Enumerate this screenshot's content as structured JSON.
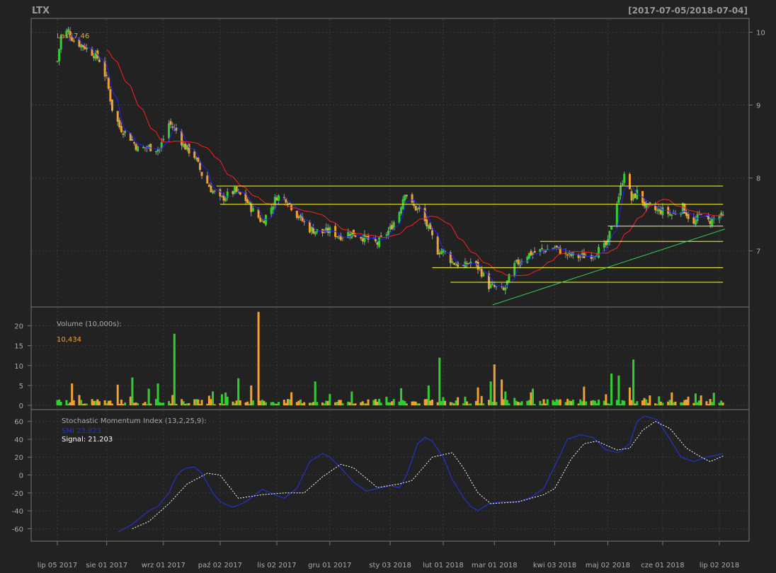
{
  "header": {
    "symbol": "LTX",
    "range": "[2017-07-05/2018-07-04]"
  },
  "colors": {
    "background": "#222222",
    "panel_border": "#777777",
    "grid": "#3a3a3a",
    "axis_text": "#aaaaaa",
    "header_text": "#999999",
    "up_candle": "#33cc33",
    "down_candle": "#f0a030",
    "wick": "#999999",
    "fast_ma": "#2222ff",
    "slow_ma": "#ff2020",
    "support_lines": "#ffff33",
    "trend_line": "#33cc55",
    "smi_line": "#2233cc",
    "signal_line": "#ffffff",
    "last_label": "#f0a030",
    "panel_label": "#aaaaaa"
  },
  "chart_data": [
    {
      "type": "candlestick",
      "panel": "price",
      "last_label": "Last 7.46",
      "ylim": [
        6.25,
        10.15
      ],
      "yticks": [
        7,
        8,
        9,
        10
      ],
      "grid": true,
      "x_labels": [
        "lip 05 2017",
        "sie 01 2017",
        "wrz 01 2017",
        "paź 02 2017",
        "lis 02 2017",
        "gru 01 2017",
        "sty 03 2018",
        "lut 01 2018",
        "mar 01 2018",
        "kwi 03 2018",
        "maj 02 2018",
        "cze 01 2018",
        "lip 02 2018"
      ],
      "x_label_dates": [
        "2017-07-05",
        "2017-08-01",
        "2017-09-01",
        "2017-10-02",
        "2017-11-02",
        "2017-12-01",
        "2018-01-03",
        "2018-02-01",
        "2018-03-01",
        "2018-04-03",
        "2018-05-02",
        "2018-06-01",
        "2018-07-02"
      ],
      "close_anchors": [
        [
          "2017-07-05",
          9.6
        ],
        [
          "2017-07-07",
          9.95
        ],
        [
          "2017-07-11",
          10.02
        ],
        [
          "2017-07-14",
          9.88
        ],
        [
          "2017-07-20",
          9.8
        ],
        [
          "2017-07-25",
          9.7
        ],
        [
          "2017-07-28",
          9.62
        ],
        [
          "2017-08-01",
          9.35
        ],
        [
          "2017-08-04",
          8.95
        ],
        [
          "2017-08-08",
          8.7
        ],
        [
          "2017-08-14",
          8.55
        ],
        [
          "2017-08-18",
          8.4
        ],
        [
          "2017-08-24",
          8.42
        ],
        [
          "2017-08-30",
          8.4
        ],
        [
          "2017-09-04",
          8.75
        ],
        [
          "2017-09-08",
          8.65
        ],
        [
          "2017-09-12",
          8.45
        ],
        [
          "2017-09-18",
          8.3
        ],
        [
          "2017-09-22",
          8.05
        ],
        [
          "2017-09-27",
          7.85
        ],
        [
          "2017-10-02",
          7.7
        ],
        [
          "2017-10-05",
          7.75
        ],
        [
          "2017-10-10",
          7.82
        ],
        [
          "2017-10-16",
          7.7
        ],
        [
          "2017-10-20",
          7.55
        ],
        [
          "2017-10-25",
          7.4
        ],
        [
          "2017-10-30",
          7.6
        ],
        [
          "2017-11-02",
          7.75
        ],
        [
          "2017-11-07",
          7.72
        ],
        [
          "2017-11-13",
          7.5
        ],
        [
          "2017-11-20",
          7.3
        ],
        [
          "2017-11-27",
          7.25
        ],
        [
          "2017-12-01",
          7.28
        ],
        [
          "2017-12-06",
          7.2
        ],
        [
          "2017-12-12",
          7.25
        ],
        [
          "2017-12-18",
          7.2
        ],
        [
          "2017-12-27",
          7.1
        ],
        [
          "2018-01-03",
          7.3
        ],
        [
          "2018-01-08",
          7.55
        ],
        [
          "2018-01-11",
          7.82
        ],
        [
          "2018-01-15",
          7.62
        ],
        [
          "2018-01-19",
          7.55
        ],
        [
          "2018-01-24",
          7.3
        ],
        [
          "2018-01-29",
          7.0
        ],
        [
          "2018-02-01",
          7.0
        ],
        [
          "2018-02-06",
          6.85
        ],
        [
          "2018-02-12",
          6.78
        ],
        [
          "2018-02-16",
          6.85
        ],
        [
          "2018-02-21",
          6.75
        ],
        [
          "2018-02-26",
          6.52
        ],
        [
          "2018-03-01",
          6.5
        ],
        [
          "2018-03-06",
          6.45
        ],
        [
          "2018-03-12",
          6.8
        ],
        [
          "2018-03-19",
          6.95
        ],
        [
          "2018-03-26",
          7.0
        ],
        [
          "2018-04-03",
          7.05
        ],
        [
          "2018-04-09",
          6.95
        ],
        [
          "2018-04-16",
          6.92
        ],
        [
          "2018-04-23",
          6.95
        ],
        [
          "2018-04-30",
          7.05
        ],
        [
          "2018-05-02",
          7.1
        ],
        [
          "2018-05-05",
          7.5
        ],
        [
          "2018-05-09",
          7.85
        ],
        [
          "2018-05-11",
          8.1
        ],
        [
          "2018-05-15",
          7.7
        ],
        [
          "2018-05-18",
          7.8
        ],
        [
          "2018-05-23",
          7.6
        ],
        [
          "2018-05-29",
          7.55
        ],
        [
          "2018-06-01",
          7.55
        ],
        [
          "2018-06-06",
          7.5
        ],
        [
          "2018-06-12",
          7.6
        ],
        [
          "2018-06-18",
          7.35
        ],
        [
          "2018-06-22",
          7.55
        ],
        [
          "2018-06-26",
          7.4
        ],
        [
          "2018-07-02",
          7.48
        ],
        [
          "2018-07-04",
          7.46
        ]
      ],
      "overlays": {
        "fast_ma_period": 5,
        "slow_ma_period": 20,
        "horizontal_lines": [
          {
            "y": 7.89,
            "from": "2017-09-30",
            "to": "2018-07-04"
          },
          {
            "y": 7.64,
            "from": "2017-10-02",
            "to": "2018-07-04"
          },
          {
            "y": 7.34,
            "from": "2018-05-02",
            "to": "2018-07-04"
          },
          {
            "y": 7.13,
            "from": "2018-03-26",
            "to": "2018-07-04"
          },
          {
            "y": 6.77,
            "from": "2018-01-26",
            "to": "2018-07-04"
          },
          {
            "y": 6.57,
            "from": "2018-02-05",
            "to": "2018-07-04"
          }
        ],
        "trend_line": {
          "from": [
            "2018-02-28",
            6.26
          ],
          "to": [
            "2018-07-05",
            7.3
          ]
        }
      }
    },
    {
      "type": "bar",
      "panel": "volume",
      "title": "Volume (10,000s):",
      "last_value": "10,434",
      "ylim": [
        0,
        24
      ],
      "yticks": [
        0,
        5,
        10,
        15,
        20
      ],
      "grid": true,
      "peaks": [
        [
          "2017-07-13",
          5.5
        ],
        [
          "2017-08-07",
          5.2
        ],
        [
          "2017-08-15",
          7.0
        ],
        [
          "2017-08-24",
          4.2
        ],
        [
          "2017-08-29",
          5.5
        ],
        [
          "2017-09-07",
          18.0
        ],
        [
          "2017-09-09",
          5.6
        ],
        [
          "2017-09-28",
          3.5
        ],
        [
          "2017-10-12",
          6.8
        ],
        [
          "2017-10-19",
          5.0
        ],
        [
          "2017-10-23",
          23.5
        ],
        [
          "2017-11-23",
          6.0
        ],
        [
          "2017-12-13",
          3.5
        ],
        [
          "2018-01-09",
          4.3
        ],
        [
          "2018-01-24",
          5.0
        ],
        [
          "2018-01-30",
          12.0
        ],
        [
          "2018-01-27",
          6.0
        ],
        [
          "2018-02-20",
          4.5
        ],
        [
          "2018-02-27",
          6.0
        ],
        [
          "2018-03-01",
          10.3
        ],
        [
          "2018-03-05",
          6.5
        ],
        [
          "2018-03-22",
          4.2
        ],
        [
          "2018-04-19",
          4.7
        ],
        [
          "2018-05-04",
          8.0
        ],
        [
          "2018-05-06",
          10.8
        ],
        [
          "2018-05-08",
          7.5
        ],
        [
          "2018-05-14",
          4.5
        ],
        [
          "2018-05-16",
          11.5
        ],
        [
          "2018-05-25",
          2.5
        ],
        [
          "2018-06-22",
          2.5
        ],
        [
          "2018-07-01",
          10.0
        ]
      ]
    },
    {
      "type": "line",
      "panel": "oscillator",
      "title": "Stochastic Momentum Index (13,2,25,9):",
      "series": [
        {
          "name": "SMI",
          "last_value": "23.823"
        },
        {
          "name": "Signal",
          "last_value": "21.203"
        }
      ],
      "ylim": [
        -70,
        70
      ],
      "yticks": [
        -60,
        -40,
        -20,
        0,
        20,
        40,
        60
      ],
      "grid": true,
      "smi_anchors": [
        [
          "2017-08-07",
          -64
        ],
        [
          "2017-08-15",
          -55
        ],
        [
          "2017-08-24",
          -40
        ],
        [
          "2017-08-29",
          -35
        ],
        [
          "2017-09-04",
          -20
        ],
        [
          "2017-09-09",
          3
        ],
        [
          "2017-09-14",
          8
        ],
        [
          "2017-09-18",
          9
        ],
        [
          "2017-09-22",
          2
        ],
        [
          "2017-09-28",
          -20
        ],
        [
          "2017-10-02",
          -30
        ],
        [
          "2017-10-09",
          -36
        ],
        [
          "2017-10-16",
          -30
        ],
        [
          "2017-10-25",
          -16
        ],
        [
          "2017-11-01",
          -22
        ],
        [
          "2017-11-06",
          -26
        ],
        [
          "2017-11-13",
          -15
        ],
        [
          "2017-11-20",
          15
        ],
        [
          "2017-11-27",
          24
        ],
        [
          "2017-12-01",
          20
        ],
        [
          "2017-12-07",
          8
        ],
        [
          "2017-12-14",
          -8
        ],
        [
          "2017-12-21",
          -18
        ],
        [
          "2017-12-27",
          -15
        ],
        [
          "2018-01-03",
          -12
        ],
        [
          "2018-01-08",
          -14
        ],
        [
          "2018-01-12",
          0
        ],
        [
          "2018-01-18",
          35
        ],
        [
          "2018-01-22",
          42
        ],
        [
          "2018-01-26",
          38
        ],
        [
          "2018-02-01",
          20
        ],
        [
          "2018-02-06",
          -5
        ],
        [
          "2018-02-12",
          -25
        ],
        [
          "2018-02-16",
          -35
        ],
        [
          "2018-02-20",
          -40
        ],
        [
          "2018-02-26",
          -32
        ],
        [
          "2018-03-05",
          -30
        ],
        [
          "2018-03-14",
          -30
        ],
        [
          "2018-03-21",
          -25
        ],
        [
          "2018-03-28",
          -15
        ],
        [
          "2018-04-03",
          10
        ],
        [
          "2018-04-10",
          40
        ],
        [
          "2018-04-17",
          45
        ],
        [
          "2018-04-24",
          42
        ],
        [
          "2018-05-01",
          28
        ],
        [
          "2018-05-08",
          25
        ],
        [
          "2018-05-14",
          35
        ],
        [
          "2018-05-18",
          60
        ],
        [
          "2018-05-22",
          66
        ],
        [
          "2018-05-29",
          62
        ],
        [
          "2018-06-05",
          40
        ],
        [
          "2018-06-11",
          20
        ],
        [
          "2018-06-18",
          15
        ],
        [
          "2018-06-25",
          20
        ],
        [
          "2018-07-04",
          23.823
        ]
      ],
      "signal_anchors": [
        [
          "2017-08-15",
          -60
        ],
        [
          "2017-08-24",
          -52
        ],
        [
          "2017-09-04",
          -32
        ],
        [
          "2017-09-14",
          -10
        ],
        [
          "2017-09-25",
          2
        ],
        [
          "2017-10-02",
          0
        ],
        [
          "2017-10-12",
          -26
        ],
        [
          "2017-10-25",
          -22
        ],
        [
          "2017-11-06",
          -20
        ],
        [
          "2017-11-17",
          -20
        ],
        [
          "2017-11-27",
          -2
        ],
        [
          "2017-12-07",
          12
        ],
        [
          "2017-12-14",
          8
        ],
        [
          "2017-12-27",
          -14
        ],
        [
          "2018-01-08",
          -10
        ],
        [
          "2018-01-15",
          -6
        ],
        [
          "2018-01-26",
          20
        ],
        [
          "2018-02-06",
          25
        ],
        [
          "2018-02-12",
          8
        ],
        [
          "2018-02-20",
          -20
        ],
        [
          "2018-02-27",
          -32
        ],
        [
          "2018-03-14",
          -30
        ],
        [
          "2018-03-28",
          -22
        ],
        [
          "2018-04-03",
          -15
        ],
        [
          "2018-04-12",
          18
        ],
        [
          "2018-04-19",
          35
        ],
        [
          "2018-04-26",
          38
        ],
        [
          "2018-05-07",
          28
        ],
        [
          "2018-05-14",
          30
        ],
        [
          "2018-05-21",
          50
        ],
        [
          "2018-05-28",
          60
        ],
        [
          "2018-06-05",
          52
        ],
        [
          "2018-06-14",
          30
        ],
        [
          "2018-06-22",
          20
        ],
        [
          "2018-06-27",
          15
        ],
        [
          "2018-07-04",
          21.203
        ]
      ]
    }
  ]
}
